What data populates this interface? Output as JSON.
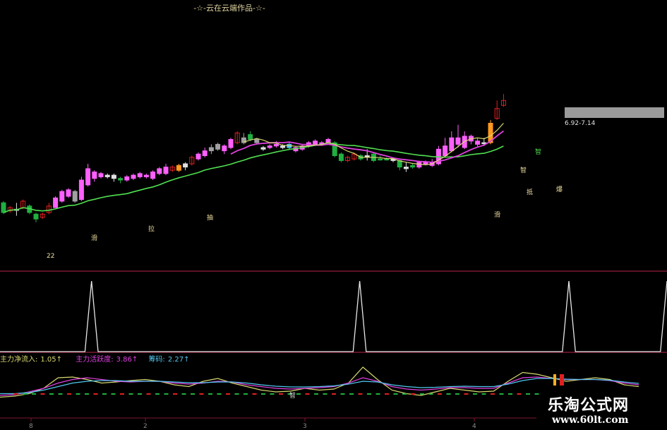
{
  "header": {
    "title": "-☆-云在云端作品-☆-"
  },
  "price_panel": {
    "range_label": "6.92-7.14",
    "markers": [
      {
        "label": "22"
      },
      {
        "label": "滑"
      },
      {
        "label": "拉"
      },
      {
        "label": "抽"
      },
      {
        "label": "智"
      },
      {
        "label": "滑"
      },
      {
        "label": "智"
      },
      {
        "label": "抵"
      },
      {
        "label": "爆"
      }
    ]
  },
  "indicator_row": {
    "items": [
      {
        "label": "主力净流入:",
        "value": "1.05↑"
      },
      {
        "label": "主力活跃度:",
        "value": "3.86↑"
      },
      {
        "label": "筹码:",
        "value": "2.27↑"
      }
    ],
    "marker": "智"
  },
  "x_axis": {
    "ticks": [
      "8",
      "2",
      "3",
      "4"
    ]
  },
  "watermark": {
    "name": "乐淘公式网",
    "url": "www.60lt.com"
  },
  "colors": {
    "up": "#e02020",
    "down": "#20b040",
    "pink": "#ff60ff",
    "grey": "#a0a0a0",
    "ma_green": "#50e050",
    "ma_magenta": "#e040e0",
    "ma_yellow": "#d8d870",
    "divider": "#7a1830"
  },
  "chart_data": [
    {
      "type": "candlestick",
      "title": "",
      "series": [
        {
          "name": "",
          "values": [
            {
              "o": 0.36,
              "c": 0.3,
              "h": 0.37,
              "l": 0.29,
              "k": "d"
            },
            {
              "o": 0.31,
              "c": 0.33,
              "h": 0.34,
              "l": 0.3,
              "k": "u"
            },
            {
              "o": 0.32,
              "c": 0.32,
              "h": 0.36,
              "l": 0.28,
              "k": "x"
            },
            {
              "o": 0.33,
              "c": 0.37,
              "h": 0.38,
              "l": 0.32,
              "k": "u"
            },
            {
              "o": 0.34,
              "c": 0.3,
              "h": 0.35,
              "l": 0.29,
              "k": "d"
            },
            {
              "o": 0.29,
              "c": 0.26,
              "h": 0.3,
              "l": 0.24,
              "k": "d"
            },
            {
              "o": 0.27,
              "c": 0.29,
              "h": 0.3,
              "l": 0.26,
              "k": "u"
            },
            {
              "o": 0.3,
              "c": 0.34,
              "h": 0.36,
              "l": 0.29,
              "k": "u"
            },
            {
              "o": 0.33,
              "c": 0.39,
              "h": 0.4,
              "l": 0.33,
              "k": "p"
            },
            {
              "o": 0.37,
              "c": 0.43,
              "h": 0.44,
              "l": 0.36,
              "k": "p"
            },
            {
              "o": 0.4,
              "c": 0.44,
              "h": 0.45,
              "l": 0.39,
              "k": "p"
            },
            {
              "o": 0.43,
              "c": 0.37,
              "h": 0.44,
              "l": 0.36,
              "k": "g"
            },
            {
              "o": 0.38,
              "c": 0.5,
              "h": 0.52,
              "l": 0.37,
              "k": "p"
            },
            {
              "o": 0.47,
              "c": 0.57,
              "h": 0.6,
              "l": 0.46,
              "k": "p"
            },
            {
              "o": 0.55,
              "c": 0.51,
              "h": 0.56,
              "l": 0.49,
              "k": "p"
            },
            {
              "o": 0.52,
              "c": 0.54,
              "h": 0.55,
              "l": 0.51,
              "k": "p"
            },
            {
              "o": 0.52,
              "c": 0.53,
              "h": 0.54,
              "l": 0.51,
              "k": "x"
            },
            {
              "o": 0.53,
              "c": 0.51,
              "h": 0.54,
              "l": 0.49,
              "k": "x"
            },
            {
              "o": 0.51,
              "c": 0.5,
              "h": 0.52,
              "l": 0.48,
              "k": "d"
            },
            {
              "o": 0.5,
              "c": 0.52,
              "h": 0.53,
              "l": 0.49,
              "k": "p"
            },
            {
              "o": 0.51,
              "c": 0.53,
              "h": 0.54,
              "l": 0.5,
              "k": "p"
            },
            {
              "o": 0.52,
              "c": 0.54,
              "h": 0.55,
              "l": 0.51,
              "k": "p"
            },
            {
              "o": 0.52,
              "c": 0.53,
              "h": 0.54,
              "l": 0.51,
              "k": "p"
            },
            {
              "o": 0.51,
              "c": 0.55,
              "h": 0.56,
              "l": 0.5,
              "k": "p"
            },
            {
              "o": 0.54,
              "c": 0.57,
              "h": 0.58,
              "l": 0.53,
              "k": "p"
            },
            {
              "o": 0.54,
              "c": 0.58,
              "h": 0.6,
              "l": 0.53,
              "k": "p"
            },
            {
              "o": 0.56,
              "c": 0.58,
              "h": 0.59,
              "l": 0.55,
              "k": "u"
            },
            {
              "o": 0.56,
              "c": 0.59,
              "h": 0.6,
              "l": 0.55,
              "k": "o"
            },
            {
              "o": 0.58,
              "c": 0.6,
              "h": 0.61,
              "l": 0.56,
              "k": "x"
            },
            {
              "o": 0.6,
              "c": 0.64,
              "h": 0.65,
              "l": 0.59,
              "k": "u"
            },
            {
              "o": 0.63,
              "c": 0.66,
              "h": 0.67,
              "l": 0.62,
              "k": "p"
            },
            {
              "o": 0.65,
              "c": 0.68,
              "h": 0.7,
              "l": 0.64,
              "k": "p"
            },
            {
              "o": 0.68,
              "c": 0.7,
              "h": 0.72,
              "l": 0.66,
              "k": "g"
            },
            {
              "o": 0.69,
              "c": 0.72,
              "h": 0.73,
              "l": 0.68,
              "k": "g"
            },
            {
              "o": 0.71,
              "c": 0.68,
              "h": 0.72,
              "l": 0.66,
              "k": "p"
            },
            {
              "o": 0.7,
              "c": 0.75,
              "h": 0.76,
              "l": 0.69,
              "k": "p"
            },
            {
              "o": 0.73,
              "c": 0.79,
              "h": 0.8,
              "l": 0.72,
              "k": "u"
            },
            {
              "o": 0.76,
              "c": 0.73,
              "h": 0.79,
              "l": 0.72,
              "k": "g"
            },
            {
              "o": 0.75,
              "c": 0.78,
              "h": 0.8,
              "l": 0.74,
              "k": "d"
            },
            {
              "o": 0.75,
              "c": 0.73,
              "h": 0.76,
              "l": 0.72,
              "k": "g"
            },
            {
              "o": 0.69,
              "c": 0.7,
              "h": 0.71,
              "l": 0.68,
              "k": "x"
            },
            {
              "o": 0.7,
              "c": 0.71,
              "h": 0.72,
              "l": 0.69,
              "k": "p"
            },
            {
              "o": 0.71,
              "c": 0.72,
              "h": 0.74,
              "l": 0.7,
              "k": "p"
            },
            {
              "o": 0.7,
              "c": 0.71,
              "h": 0.72,
              "l": 0.69,
              "k": "x"
            },
            {
              "o": 0.7,
              "c": 0.72,
              "h": 0.73,
              "l": 0.69,
              "k": "c"
            },
            {
              "o": 0.7,
              "c": 0.68,
              "h": 0.71,
              "l": 0.67,
              "k": "p"
            },
            {
              "o": 0.69,
              "c": 0.71,
              "h": 0.72,
              "l": 0.68,
              "k": "p"
            },
            {
              "o": 0.71,
              "c": 0.73,
              "h": 0.74,
              "l": 0.7,
              "k": "p"
            },
            {
              "o": 0.72,
              "c": 0.74,
              "h": 0.75,
              "l": 0.71,
              "k": "p"
            },
            {
              "o": 0.72,
              "c": 0.73,
              "h": 0.74,
              "l": 0.71,
              "k": "p"
            },
            {
              "o": 0.73,
              "c": 0.75,
              "h": 0.76,
              "l": 0.72,
              "k": "p"
            },
            {
              "o": 0.73,
              "c": 0.65,
              "h": 0.74,
              "l": 0.64,
              "k": "d"
            },
            {
              "o": 0.66,
              "c": 0.62,
              "h": 0.67,
              "l": 0.61,
              "k": "d"
            },
            {
              "o": 0.62,
              "c": 0.64,
              "h": 0.65,
              "l": 0.61,
              "k": "u"
            },
            {
              "o": 0.63,
              "c": 0.66,
              "h": 0.67,
              "l": 0.62,
              "k": "u"
            },
            {
              "o": 0.65,
              "c": 0.63,
              "h": 0.66,
              "l": 0.62,
              "k": "d"
            },
            {
              "o": 0.65,
              "c": 0.65,
              "h": 0.69,
              "l": 0.62,
              "k": "x"
            },
            {
              "o": 0.66,
              "c": 0.62,
              "h": 0.67,
              "l": 0.61,
              "k": "d"
            },
            {
              "o": 0.63,
              "c": 0.63,
              "h": 0.65,
              "l": 0.62,
              "k": "d"
            },
            {
              "o": 0.63,
              "c": 0.63,
              "h": 0.64,
              "l": 0.62,
              "k": "d"
            },
            {
              "o": 0.62,
              "c": 0.63,
              "h": 0.64,
              "l": 0.61,
              "k": "x"
            },
            {
              "o": 0.62,
              "c": 0.58,
              "h": 0.63,
              "l": 0.56,
              "k": "d"
            },
            {
              "o": 0.57,
              "c": 0.58,
              "h": 0.61,
              "l": 0.55,
              "k": "x"
            },
            {
              "o": 0.58,
              "c": 0.59,
              "h": 0.6,
              "l": 0.57,
              "k": "d"
            },
            {
              "o": 0.58,
              "c": 0.61,
              "h": 0.62,
              "l": 0.57,
              "k": "p"
            },
            {
              "o": 0.6,
              "c": 0.61,
              "h": 0.62,
              "l": 0.59,
              "k": "p"
            },
            {
              "o": 0.59,
              "c": 0.61,
              "h": 0.63,
              "l": 0.58,
              "k": "p"
            },
            {
              "o": 0.6,
              "c": 0.69,
              "h": 0.71,
              "l": 0.59,
              "k": "p"
            },
            {
              "o": 0.65,
              "c": 0.71,
              "h": 0.76,
              "l": 0.64,
              "k": "p"
            },
            {
              "o": 0.68,
              "c": 0.76,
              "h": 0.8,
              "l": 0.67,
              "k": "p"
            },
            {
              "o": 0.72,
              "c": 0.76,
              "h": 0.84,
              "l": 0.7,
              "k": "p"
            },
            {
              "o": 0.7,
              "c": 0.77,
              "h": 0.8,
              "l": 0.69,
              "k": "p"
            },
            {
              "o": 0.74,
              "c": 0.77,
              "h": 0.78,
              "l": 0.72,
              "k": "p"
            },
            {
              "o": 0.72,
              "c": 0.74,
              "h": 0.76,
              "l": 0.7,
              "k": "p"
            },
            {
              "o": 0.73,
              "c": 0.73,
              "h": 0.76,
              "l": 0.71,
              "k": "x"
            },
            {
              "o": 0.73,
              "c": 0.85,
              "h": 0.87,
              "l": 0.72,
              "k": "o"
            },
            {
              "o": 0.88,
              "c": 0.94,
              "h": 0.99,
              "l": 0.87,
              "k": "u"
            },
            {
              "o": 0.96,
              "c": 0.99,
              "h": 1.03,
              "l": 0.95,
              "k": "u"
            }
          ]
        }
      ]
    },
    {
      "type": "line",
      "title": "",
      "series": [
        {
          "name": "",
          "values": [
            0,
            0,
            0,
            0,
            0,
            0,
            0,
            0,
            0,
            0,
            0,
            0,
            0,
            0,
            1,
            0,
            0,
            0,
            0,
            0,
            0,
            0,
            0,
            0,
            0,
            0,
            0,
            0,
            0,
            0,
            0,
            0,
            0,
            0,
            0,
            0,
            0,
            0,
            0,
            0,
            0,
            0,
            0,
            0,
            0,
            0,
            0,
            0,
            0,
            0,
            0,
            0,
            0,
            0,
            0,
            1,
            0,
            0,
            0,
            0,
            0,
            0,
            0,
            0,
            0,
            0,
            0,
            0,
            0,
            0,
            0,
            0,
            0,
            0,
            0,
            0,
            0,
            0,
            0,
            0,
            0,
            0,
            0,
            0,
            0,
            0,
            0,
            1,
            0,
            0,
            0,
            0,
            0,
            0,
            0,
            0,
            0,
            0,
            0,
            0,
            0,
            0,
            1
          ]
        }
      ]
    },
    {
      "type": "line",
      "title": "",
      "series": [
        {
          "name": "主力净流入",
          "values": [
            0.05,
            0.08,
            0.15,
            0.3,
            0.6,
            0.62,
            0.55,
            0.45,
            0.48,
            0.52,
            0.55,
            0.5,
            0.4,
            0.35,
            0.5,
            0.58,
            0.45,
            0.35,
            0.25,
            0.2,
            0.22,
            0.3,
            0.25,
            0.28,
            0.45,
            0.9,
            0.55,
            0.25,
            0.15,
            0.1,
            0.2,
            0.3,
            0.25,
            0.2,
            0.22,
            0.5,
            0.75,
            0.7,
            0.6,
            0.5,
            0.55,
            0.6,
            0.55,
            0.4,
            0.35
          ]
        },
        {
          "name": "主力活跃度",
          "values": [
            0.1,
            0.12,
            0.2,
            0.3,
            0.45,
            0.55,
            0.6,
            0.55,
            0.5,
            0.48,
            0.5,
            0.5,
            0.45,
            0.42,
            0.45,
            0.5,
            0.48,
            0.4,
            0.35,
            0.3,
            0.28,
            0.3,
            0.32,
            0.35,
            0.45,
            0.6,
            0.5,
            0.35,
            0.28,
            0.25,
            0.28,
            0.32,
            0.32,
            0.3,
            0.3,
            0.45,
            0.6,
            0.62,
            0.58,
            0.55,
            0.55,
            0.55,
            0.52,
            0.45,
            0.4
          ]
        },
        {
          "name": "筹码",
          "values": [
            0.15,
            0.15,
            0.18,
            0.25,
            0.35,
            0.45,
            0.5,
            0.52,
            0.52,
            0.5,
            0.5,
            0.5,
            0.48,
            0.46,
            0.46,
            0.48,
            0.48,
            0.45,
            0.4,
            0.36,
            0.34,
            0.34,
            0.35,
            0.37,
            0.42,
            0.5,
            0.48,
            0.4,
            0.35,
            0.32,
            0.33,
            0.35,
            0.36,
            0.35,
            0.35,
            0.42,
            0.52,
            0.58,
            0.58,
            0.56,
            0.55,
            0.55,
            0.53,
            0.48,
            0.44
          ]
        }
      ]
    }
  ]
}
